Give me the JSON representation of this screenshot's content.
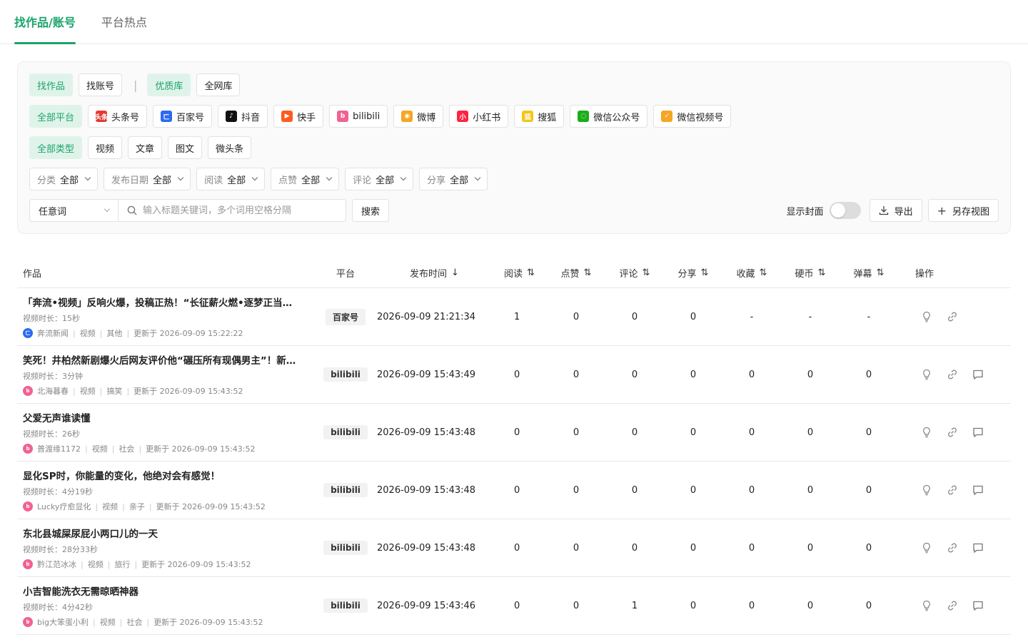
{
  "top_tabs": [
    {
      "label": "找作品/账号",
      "active": true
    },
    {
      "label": "平台热点",
      "active": false
    }
  ],
  "mode_row": {
    "items": [
      "找作品",
      "找账号"
    ],
    "lib_items": [
      "优质库",
      "全网库"
    ],
    "separator": "|"
  },
  "platform_row": {
    "all": "全部平台",
    "items": [
      {
        "label": "头条号",
        "icon": "toutiao-icon",
        "color": "#e23a32",
        "glyph": "头条"
      },
      {
        "label": "百家号",
        "icon": "baijiahao-icon",
        "color": "#2c6bf0",
        "glyph": "ㄈ"
      },
      {
        "label": "抖音",
        "icon": "douyin-icon",
        "color": "#111111",
        "glyph": "♪"
      },
      {
        "label": "快手",
        "icon": "kuaishou-icon",
        "color": "#ff5a1f",
        "glyph": "▶"
      },
      {
        "label": "bilibili",
        "icon": "bilibili-icon",
        "color": "#f06292",
        "glyph": "b"
      },
      {
        "label": "微博",
        "icon": "weibo-icon",
        "color": "#f5a623",
        "glyph": "◉"
      },
      {
        "label": "小红书",
        "icon": "xiaohongshu-icon",
        "color": "#ff2442",
        "glyph": "小"
      },
      {
        "label": "搜狐",
        "icon": "sohu-icon",
        "color": "#f5c518",
        "glyph": "狐"
      },
      {
        "label": "微信公众号",
        "icon": "wechat-mp-icon",
        "color": "#1aad19",
        "glyph": "◌"
      },
      {
        "label": "微信视频号",
        "icon": "wechat-channels-icon",
        "color": "#f5a623",
        "glyph": "✓"
      }
    ]
  },
  "type_row": {
    "all": "全部类型",
    "items": [
      "视频",
      "文章",
      "图文",
      "微头条"
    ]
  },
  "dropdowns": [
    {
      "key": "分类",
      "value": "全部"
    },
    {
      "key": "发布日期",
      "value": "全部"
    },
    {
      "key": "阅读",
      "value": "全部"
    },
    {
      "key": "点赞",
      "value": "全部"
    },
    {
      "key": "评论",
      "value": "全部"
    },
    {
      "key": "分享",
      "value": "全部"
    }
  ],
  "search": {
    "scope": "任意词",
    "placeholder": "输入标题关键词，多个词用空格分隔",
    "button": "搜索"
  },
  "tools": {
    "show_cover_label": "显示封面",
    "show_cover_on": false,
    "export_label": "导出",
    "save_view_label": "另存视图"
  },
  "table": {
    "headers": {
      "work": "作品",
      "platform": "平台",
      "time": "发布时间",
      "read": "阅读",
      "like": "点赞",
      "comment": "评论",
      "share": "分享",
      "fav": "收藏",
      "coin": "硬币",
      "danmaku": "弹幕",
      "ops": "操作"
    },
    "rows": [
      {
        "title": "「奔流•视频」反响火爆，投稿正热！“长征薪火燃•逐梦正当…",
        "duration": "视频时长：15秒",
        "author": "奔流新闻",
        "kind": "视频",
        "category": "其他",
        "updated": "更新于 2026-09-09 15:22:22",
        "platform": "百家号",
        "avatar_color": "#2c6bf0",
        "avatar_glyph": "ㄈ",
        "time": "2026-09-09 21:21:34",
        "read": "1",
        "like": "0",
        "comment": "0",
        "share": "0",
        "fav": "-",
        "coin": "-",
        "danmaku": "-",
        "has_comment_op": false
      },
      {
        "title": "笑死！井柏然新剧爆火后网友评价他“碾压所有现偶男主”！新…",
        "duration": "视频时长：3分钟",
        "author": "北海暮春",
        "kind": "视频",
        "category": "搞笑",
        "updated": "更新于 2026-09-09 15:43:52",
        "platform": "bilibili",
        "avatar_color": "#f06292",
        "avatar_glyph": "b",
        "time": "2026-09-09 15:43:49",
        "read": "0",
        "like": "0",
        "comment": "0",
        "share": "0",
        "fav": "0",
        "coin": "0",
        "danmaku": "0",
        "has_comment_op": true
      },
      {
        "title": "父爱无声谁读懂",
        "duration": "视频时长：26秒",
        "author": "普渡缘1172",
        "kind": "视频",
        "category": "社会",
        "updated": "更新于 2026-09-09 15:43:52",
        "platform": "bilibili",
        "avatar_color": "#f06292",
        "avatar_glyph": "b",
        "time": "2026-09-09 15:43:48",
        "read": "0",
        "like": "0",
        "comment": "0",
        "share": "0",
        "fav": "0",
        "coin": "0",
        "danmaku": "0",
        "has_comment_op": true
      },
      {
        "title": "显化SP时，你能量的变化，他绝对会有感觉！",
        "duration": "视频时长：4分19秒",
        "author": "Lucky疗愈显化",
        "kind": "视频",
        "category": "亲子",
        "updated": "更新于 2026-09-09 15:43:52",
        "platform": "bilibili",
        "avatar_color": "#f06292",
        "avatar_glyph": "b",
        "time": "2026-09-09 15:43:48",
        "read": "0",
        "like": "0",
        "comment": "0",
        "share": "0",
        "fav": "0",
        "coin": "0",
        "danmaku": "0",
        "has_comment_op": true
      },
      {
        "title": "东北县城屎尿屁小两口儿的一天",
        "duration": "视频时长：28分33秒",
        "author": "黔江范冰冰",
        "kind": "视频",
        "category": "旅行",
        "updated": "更新于 2026-09-09 15:43:52",
        "platform": "bilibili",
        "avatar_color": "#f06292",
        "avatar_glyph": "b",
        "time": "2026-09-09 15:43:48",
        "read": "0",
        "like": "0",
        "comment": "0",
        "share": "0",
        "fav": "0",
        "coin": "0",
        "danmaku": "0",
        "has_comment_op": true
      },
      {
        "title": "小吉智能洗衣无需晾晒神器",
        "duration": "视频时长：4分42秒",
        "author": "big大笨蛋小利",
        "kind": "视频",
        "category": "社会",
        "updated": "更新于 2026-09-09 15:43:52",
        "platform": "bilibili",
        "avatar_color": "#f06292",
        "avatar_glyph": "b",
        "time": "2026-09-09 15:43:46",
        "read": "0",
        "like": "0",
        "comment": "1",
        "share": "0",
        "fav": "0",
        "coin": "0",
        "danmaku": "0",
        "has_comment_op": true
      }
    ]
  }
}
